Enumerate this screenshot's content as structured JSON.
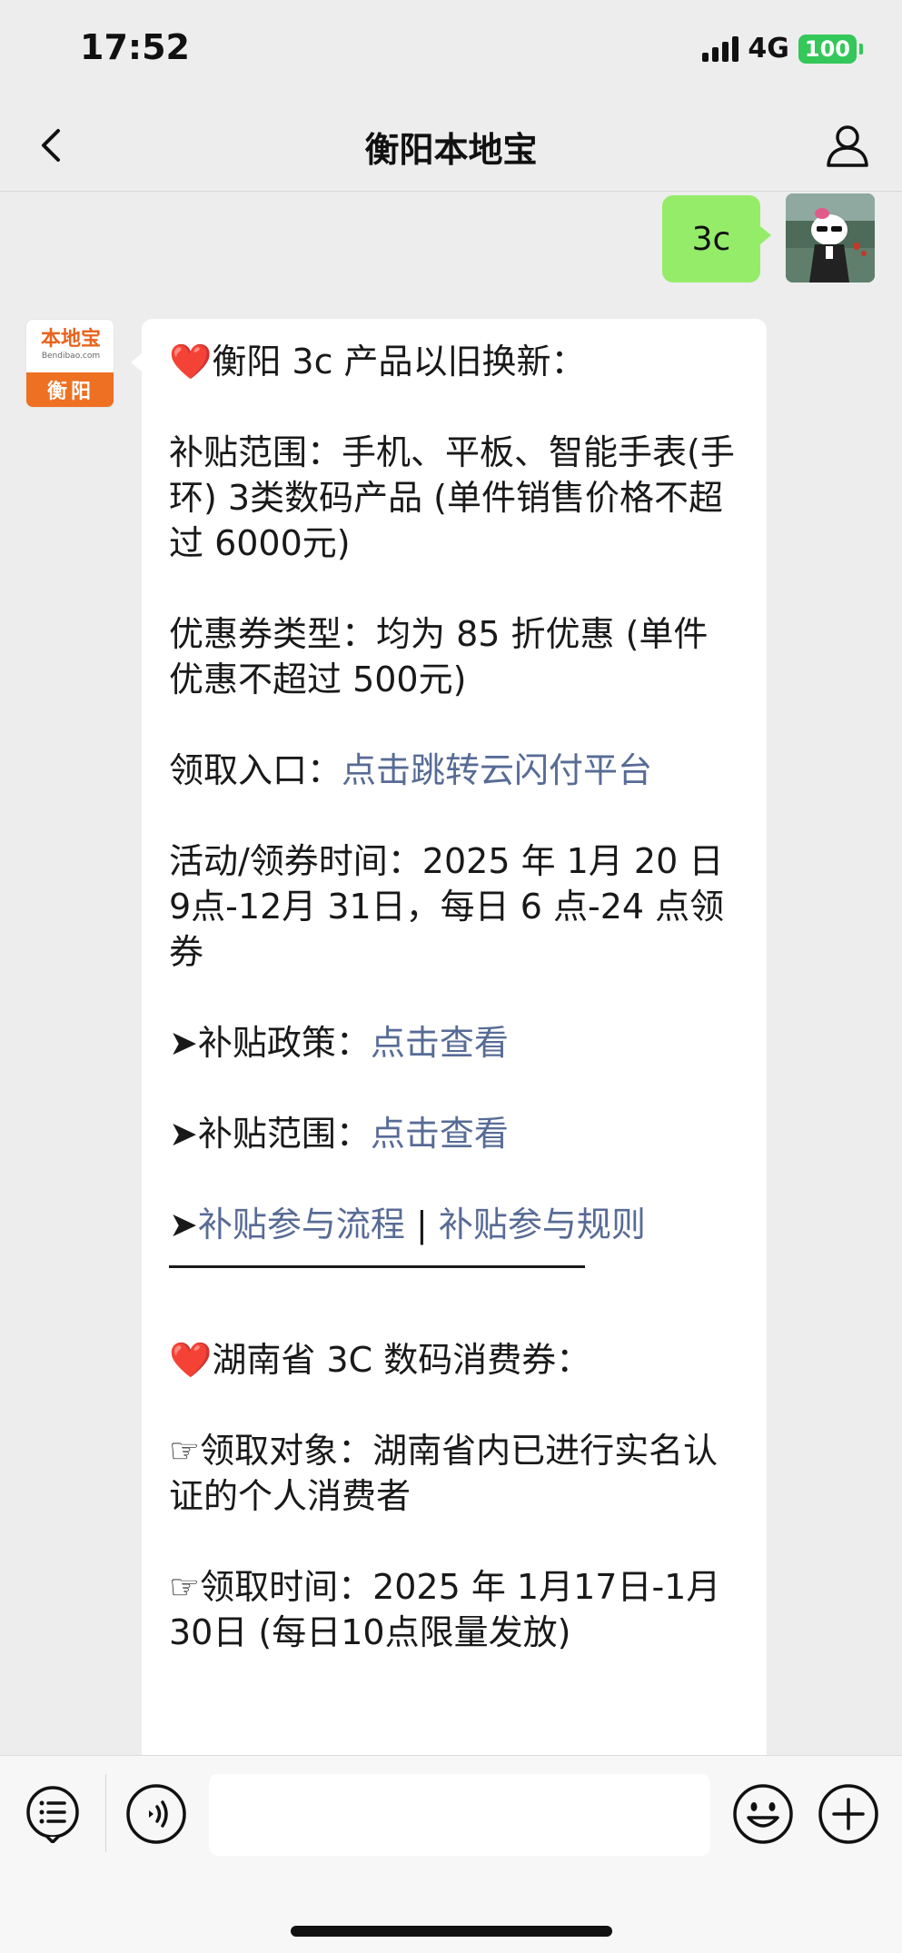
{
  "status_bar": {
    "time": "17:52",
    "network": "4G",
    "battery": "100",
    "colors": {
      "battery": "#34c759"
    }
  },
  "nav": {
    "title": "衡阳本地宝",
    "back_icon": "chevron-left-icon",
    "profile_icon": "person-icon"
  },
  "chat": {
    "sent_message": {
      "text": "3c",
      "bubble_color": "#95ec69"
    },
    "bot_avatar": {
      "name": "本地宝",
      "url": "Bendibao.com",
      "city": "衡阳"
    },
    "received_message": {
      "link_color": "#576b95",
      "heart_1": "❤️",
      "title_1": "衡阳 3c 产品以旧换新：",
      "scope": "补贴范围：手机、平板、智能手表(手环) 3类数码产品 (单件销售价格不超过 6000元)",
      "coupon_type": "优惠券类型：均为 85 折优惠 (单件优惠不超过 500元)",
      "entry_label": "领取入口：",
      "entry_link": "点击跳转云闪付平台",
      "activity_time": "活动/领券时间：2025 年 1月 20 日 9点-12月 31日，每日 6 点-24 点领券",
      "policy_label": "➤补贴政策：",
      "policy_link": "点击查看",
      "range_label": "➤补贴范围：",
      "range_link": "点击查看",
      "arrow": "➤",
      "process_link": "补贴参与流程",
      "separator": "|",
      "rules_link": "补贴参与规则",
      "heart_2": "❤️",
      "title_2": "湖南省 3C 数码消费券：",
      "target": "☞领取对象：湖南省内已进行实名认证的个人消费者",
      "claim_time": "☞领取时间：2025 年 1月17日-1月30日 (每日10点限量发放)"
    }
  },
  "input_bar": {
    "menu_icon": "list-menu-icon",
    "voice_icon": "voice-icon",
    "emoji_icon": "smiley-icon",
    "plus_icon": "plus-icon",
    "input_value": ""
  }
}
